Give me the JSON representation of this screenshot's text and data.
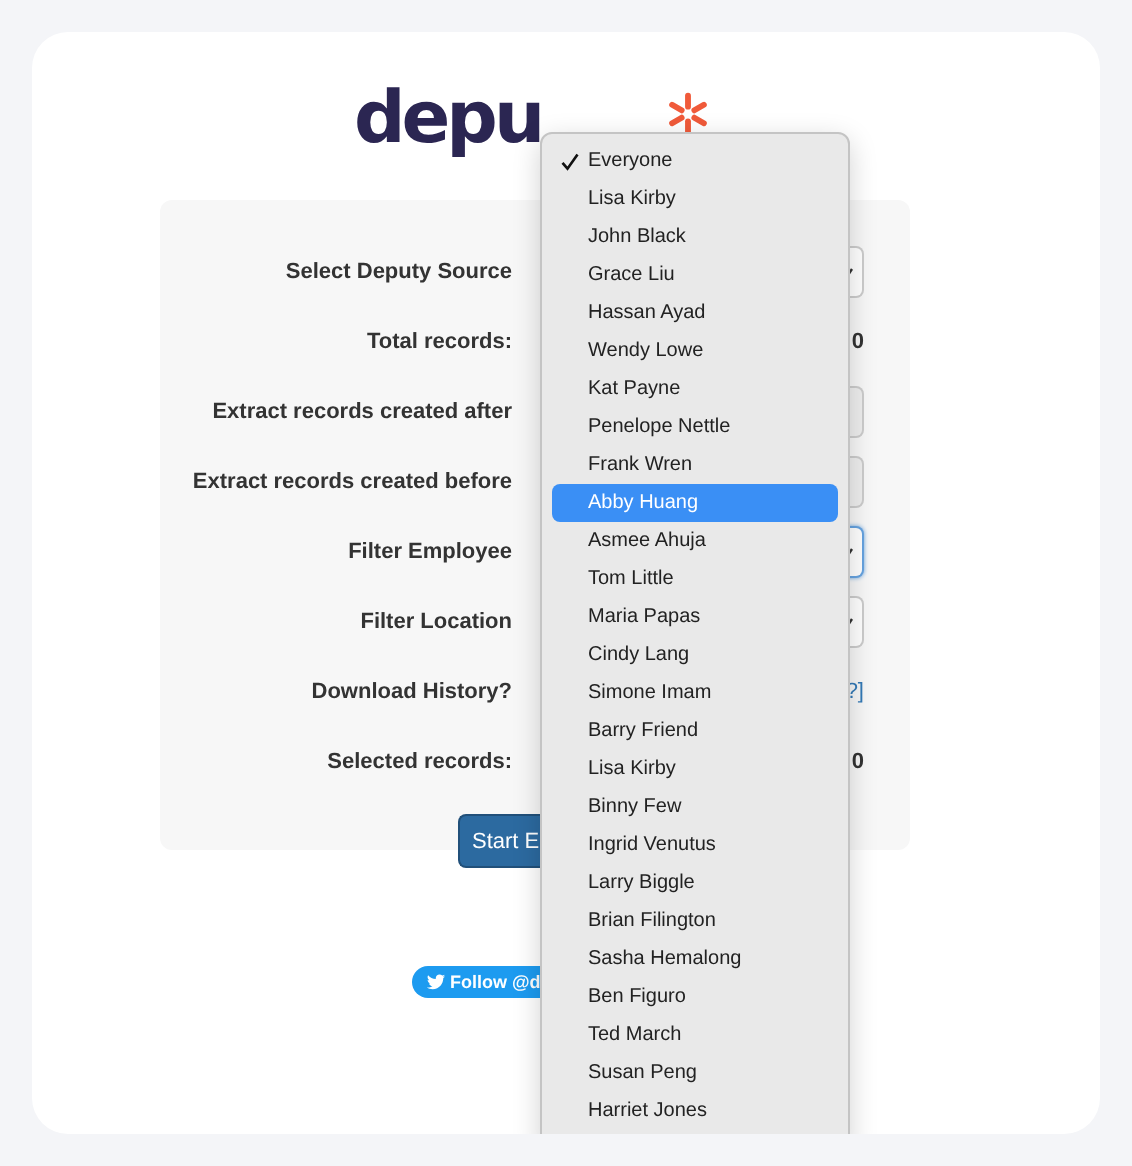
{
  "logo": {
    "text": "depu"
  },
  "form": {
    "rows": [
      {
        "label": "Select Deputy Source",
        "kind": "select",
        "focused": false
      },
      {
        "label": "Total records:",
        "kind": "value",
        "value": "0"
      },
      {
        "label": "Extract records created after",
        "kind": "date"
      },
      {
        "label": "Extract records created before",
        "kind": "date"
      },
      {
        "label": "Filter Employee",
        "kind": "select",
        "focused": true
      },
      {
        "label": "Filter Location",
        "kind": "select",
        "focused": false
      },
      {
        "label": "Download History?",
        "kind": "link",
        "value": "?]"
      },
      {
        "label": "Selected records:",
        "kind": "value",
        "value": "0"
      }
    ],
    "button": "Start E"
  },
  "follow_button": "Follow @d",
  "dropdown": {
    "items": [
      {
        "label": "Everyone",
        "checked": true,
        "selected": false
      },
      {
        "label": "Lisa Kirby",
        "checked": false,
        "selected": false
      },
      {
        "label": "John Black",
        "checked": false,
        "selected": false
      },
      {
        "label": "Grace Liu",
        "checked": false,
        "selected": false
      },
      {
        "label": "Hassan Ayad",
        "checked": false,
        "selected": false
      },
      {
        "label": "Wendy Lowe",
        "checked": false,
        "selected": false
      },
      {
        "label": "Kat Payne",
        "checked": false,
        "selected": false
      },
      {
        "label": "Penelope Nettle",
        "checked": false,
        "selected": false
      },
      {
        "label": "Frank Wren",
        "checked": false,
        "selected": false
      },
      {
        "label": "Abby Huang",
        "checked": false,
        "selected": true
      },
      {
        "label": "Asmee Ahuja",
        "checked": false,
        "selected": false
      },
      {
        "label": "Tom Little",
        "checked": false,
        "selected": false
      },
      {
        "label": "Maria Papas",
        "checked": false,
        "selected": false
      },
      {
        "label": "Cindy Lang",
        "checked": false,
        "selected": false
      },
      {
        "label": "Simone Imam",
        "checked": false,
        "selected": false
      },
      {
        "label": "Barry Friend",
        "checked": false,
        "selected": false
      },
      {
        "label": "Lisa Kirby",
        "checked": false,
        "selected": false
      },
      {
        "label": "Binny Few",
        "checked": false,
        "selected": false
      },
      {
        "label": "Ingrid Venutus",
        "checked": false,
        "selected": false
      },
      {
        "label": "Larry Biggle",
        "checked": false,
        "selected": false
      },
      {
        "label": "Brian Filington",
        "checked": false,
        "selected": false
      },
      {
        "label": "Sasha Hemalong",
        "checked": false,
        "selected": false
      },
      {
        "label": "Ben Figuro",
        "checked": false,
        "selected": false
      },
      {
        "label": "Ted March",
        "checked": false,
        "selected": false
      },
      {
        "label": "Susan Peng",
        "checked": false,
        "selected": false
      },
      {
        "label": "Harriet Jones",
        "checked": false,
        "selected": false
      }
    ]
  }
}
